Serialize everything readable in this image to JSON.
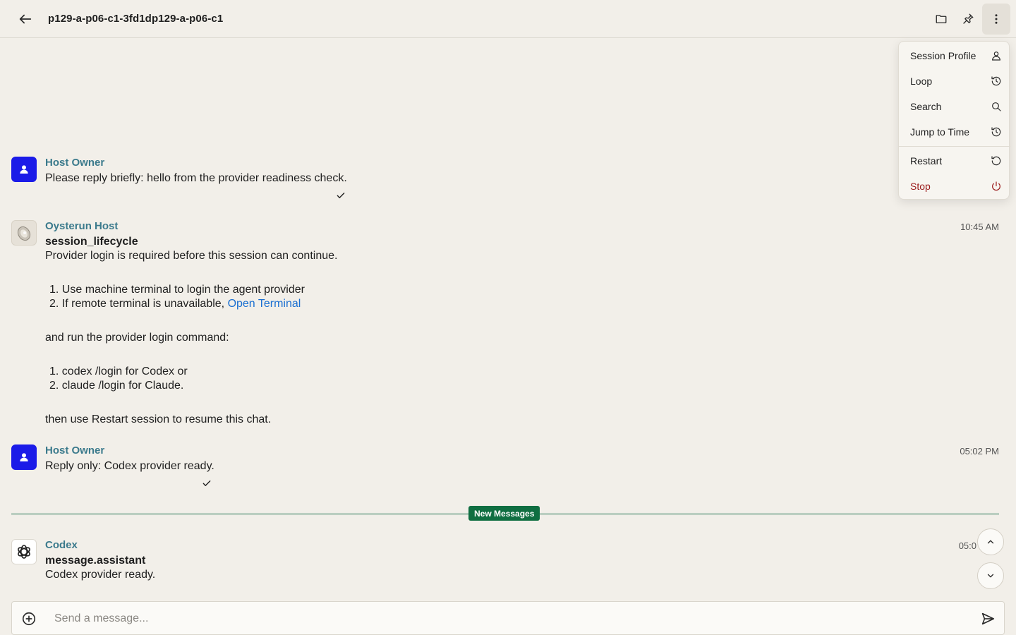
{
  "header": {
    "session_title": "p129-a-p06-c1-3fd1dp129-a-p06-c1"
  },
  "menu": {
    "items": [
      {
        "label": "Session Profile",
        "icon": "user-icon"
      },
      {
        "label": "Loop",
        "icon": "history-icon"
      },
      {
        "label": "Search",
        "icon": "search-icon"
      },
      {
        "label": "Jump to Time",
        "icon": "history-icon"
      },
      {
        "label": "Restart",
        "icon": "restart-icon"
      },
      {
        "label": "Stop",
        "icon": "power-icon",
        "color": "#9b1c1c"
      }
    ]
  },
  "messages": [
    {
      "sender": "Host Owner",
      "text": "Please reply briefly: hello from the provider readiness check."
    },
    {
      "sender": "Oysterun Host",
      "time": "10:45 AM",
      "event": "session_lifecycle",
      "intro": "Provider login is required before this session can continue.",
      "steps": [
        "1. Use machine terminal to login the agent provider",
        "2. If remote terminal is unavailable, "
      ],
      "link": "Open Terminal",
      "mid": "and run the provider login command:",
      "commands": [
        "1. codex /login for Codex or",
        "2. claude /login for Claude."
      ],
      "outro": "then use Restart session to resume this chat."
    },
    {
      "sender": "Host Owner",
      "time": "05:02 PM",
      "text": "Reply only: Codex provider ready."
    },
    {
      "sender": "Codex",
      "time": "05:0",
      "event": "message.assistant",
      "text": "Codex provider ready."
    }
  ],
  "divider": {
    "label": "New Messages",
    "color": "#0f6e41"
  },
  "composer": {
    "placeholder": "Send a message..."
  },
  "colors": {
    "background": "#f2efe9",
    "sender": "#3b7a8c",
    "user_avatar": "#1b1be8",
    "link": "#1a6fd1"
  }
}
